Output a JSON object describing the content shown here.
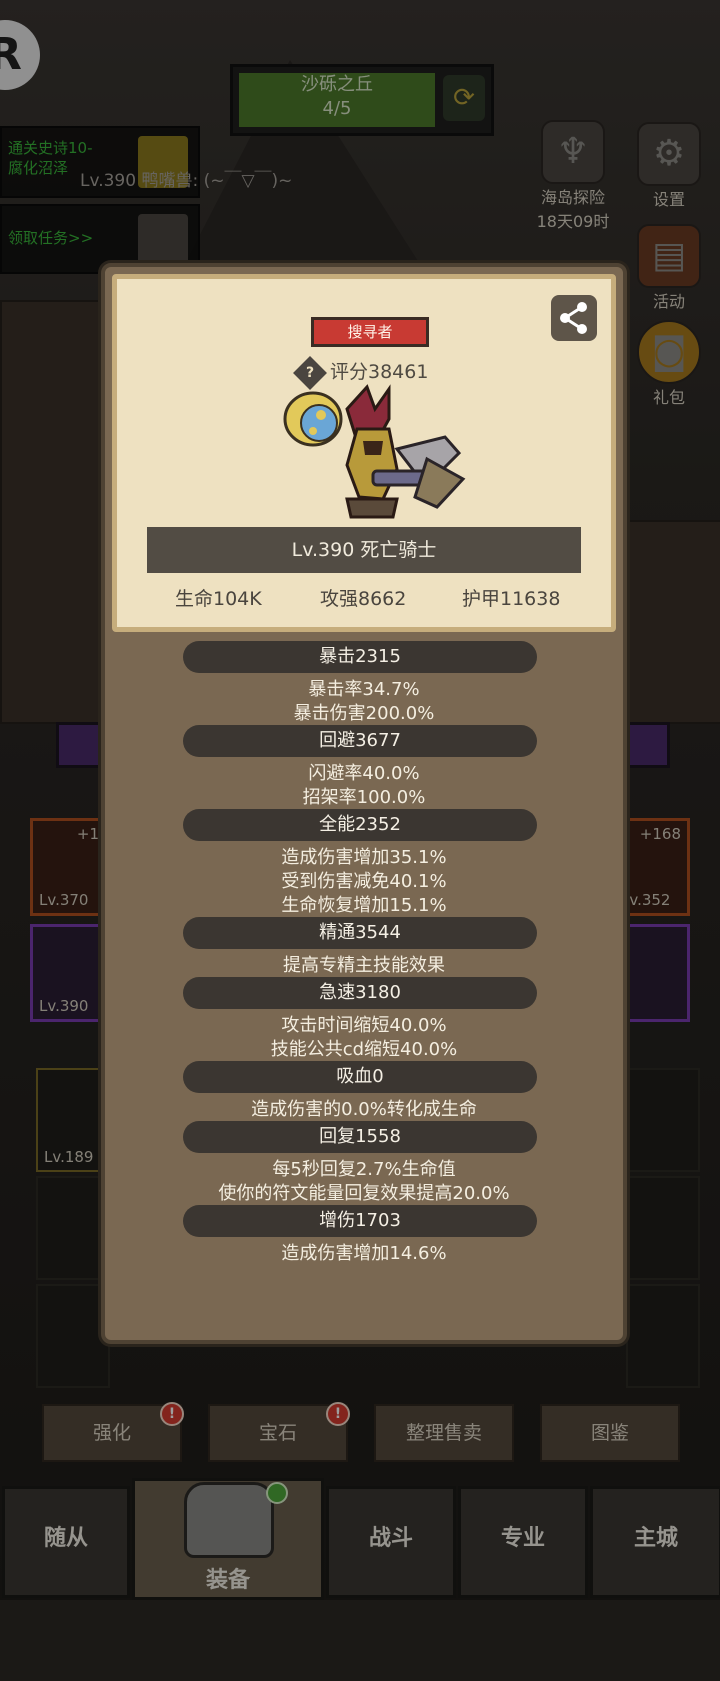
{
  "background": {
    "zone": {
      "name": "沙砾之丘",
      "progress": "4/5"
    },
    "quests": [
      {
        "line1": "通关史诗10-",
        "line2": "腐化沼泽"
      },
      {
        "line1": "领取任务>>"
      }
    ],
    "mini_text": "Lv.390 鸭嘴兽: (~￣▽￣)~",
    "right_buttons": [
      {
        "label": "海岛探险",
        "sub": "18天09时"
      },
      {
        "label": "设置"
      },
      {
        "label": "活动"
      },
      {
        "label": "礼包"
      }
    ],
    "slots": [
      {
        "plus": "+1",
        "level": "Lv.370"
      },
      {
        "level": "Lv.390"
      },
      {
        "plus": "+168",
        "level": "Lv.352"
      }
    ],
    "inventory_item_level": "Lv.189",
    "action_buttons": [
      {
        "label": "强化",
        "badge": "!"
      },
      {
        "label": "宝石",
        "badge": "!"
      },
      {
        "label": "整理售卖"
      },
      {
        "label": "图鉴"
      }
    ],
    "bottom_tabs": [
      "随从",
      "装备",
      "战斗",
      "专业",
      "主城"
    ],
    "corner_logo": "R"
  },
  "popup": {
    "role": "搜寻者",
    "score": "评分38461",
    "score_help": "?",
    "hero_name": "Lv.390 死亡骑士",
    "summary": {
      "hp": "生命104K",
      "attack": "攻强8662",
      "armor": "护甲11638"
    },
    "sections": [
      {
        "title": "暴击2315",
        "lines": [
          "暴击率34.7%",
          "暴击伤害200.0%"
        ]
      },
      {
        "title": "回避3677",
        "lines": [
          "闪避率40.0%",
          "招架率100.0%"
        ]
      },
      {
        "title": "全能2352",
        "lines": [
          "造成伤害增加35.1%",
          "受到伤害减免40.1%",
          "生命恢复增加15.1%"
        ]
      },
      {
        "title": "精通3544",
        "lines": [
          "提高专精主技能效果"
        ]
      },
      {
        "title": "急速3180",
        "lines": [
          "攻击时间缩短40.0%",
          "技能公共cd缩短40.0%"
        ]
      },
      {
        "title": "吸血0",
        "lines": [
          "造成伤害的0.0%转化成生命"
        ]
      },
      {
        "title": "回复1558",
        "lines": [
          "每5秒回复2.7%生命值",
          "使你的符文能量回复效果提高20.0%"
        ]
      },
      {
        "title": "增伤1703",
        "lines": [
          "造成伤害增加14.6%"
        ]
      }
    ]
  },
  "colors": {
    "role_tag": "#c83a33",
    "quest_text": "#39b53a",
    "zone_bar": "#4c7a2a"
  }
}
